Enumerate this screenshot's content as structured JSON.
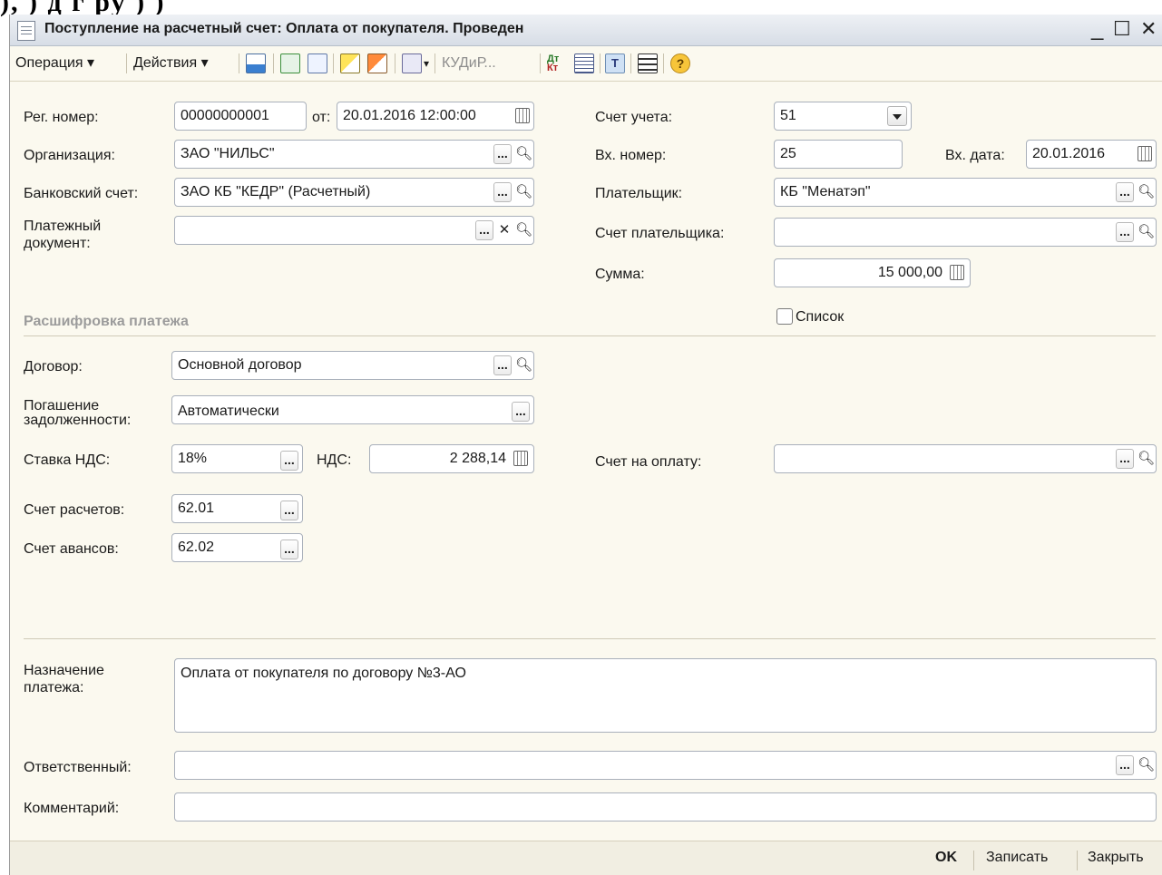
{
  "window": {
    "title": "Поступление на расчетный счет: Оплата от покупателя. Проведен",
    "controls": [
      "_",
      "☐",
      "✕"
    ]
  },
  "toolbar": {
    "operation_label": "Операция",
    "actions_label": "Действия",
    "kud_label": "КУДиР...",
    "icons": [
      "post-icon",
      "refresh-icon",
      "copy-icon",
      "import-icon",
      "export-icon",
      "based-on-icon",
      "dt-kt-icon",
      "report-icon",
      "font-icon",
      "structure-icon",
      "help-icon"
    ]
  },
  "form": {
    "reg_number_label": "Рег. номер:",
    "reg_number": "00000000001",
    "from_label": "от:",
    "doc_date": "20.01.2016 12:00:00",
    "organization_label": "Организация:",
    "organization": "ЗАО \"НИЛЬС\"",
    "bank_account_label": "Банковский счет:",
    "bank_account": "ЗАО КБ \"КЕДР\" (Расчетный)",
    "payment_doc_label_1": "Платежный",
    "payment_doc_label_2": "документ:",
    "payment_doc": "",
    "account_label": "Счет учета:",
    "account": "51",
    "in_number_label": "Вх. номер:",
    "in_number": "25",
    "in_date_label": "Вх. дата:",
    "in_date": "20.01.2016",
    "payer_label": "Плательщик:",
    "payer": "КБ \"Менатэп\"",
    "payer_account_label": "Счет плательщика:",
    "payer_account": "",
    "sum_label": "Сумма:",
    "sum": "15 000,00",
    "list_checkbox_label": "Список",
    "list_checked": false
  },
  "decoding": {
    "section_title": "Расшифровка платежа",
    "contract_label": "Договор:",
    "contract": "Основной договор",
    "debt_label_1": "Погашение",
    "debt_label_2": "задолженности:",
    "debt": "Автоматически",
    "vat_rate_label": "Ставка НДС:",
    "vat_rate": "18%",
    "vat_label": "НДС:",
    "vat": "2 288,14",
    "invoice_label": "Счет на оплату:",
    "invoice": "",
    "settlement_account_label": "Счет расчетов:",
    "settlement_account": "62.01",
    "advance_account_label": "Счет авансов:",
    "advance_account": "62.02"
  },
  "bottom": {
    "purpose_label_1": "Назначение",
    "purpose_label_2": "платежа:",
    "purpose": "Оплата от покупателя по договору №3-АО",
    "responsible_label": "Ответственный:",
    "responsible": "",
    "comment_label": "Комментарий:",
    "comment": ""
  },
  "footer": {
    "ok_label": "OK",
    "save_label": "Записать",
    "close_label": "Закрыть"
  }
}
